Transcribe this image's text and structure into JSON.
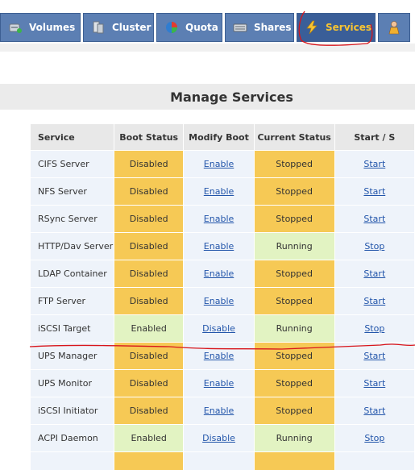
{
  "nav": {
    "tabs": [
      {
        "label": "Volumes",
        "icon": "volumes-icon",
        "active": false
      },
      {
        "label": "Cluster",
        "icon": "cluster-icon",
        "active": false
      },
      {
        "label": "Quota",
        "icon": "quota-icon",
        "active": false
      },
      {
        "label": "Shares",
        "icon": "shares-icon",
        "active": false
      },
      {
        "label": "Services",
        "icon": "lightning-icon",
        "active": true
      },
      {
        "label": "",
        "icon": "user-icon",
        "active": false
      }
    ]
  },
  "page": {
    "title": "Manage Services"
  },
  "table": {
    "headers": [
      "Service",
      "Boot Status",
      "Modify Boot",
      "Current Status",
      "Start / S"
    ],
    "rows": [
      {
        "service": "CIFS Server",
        "boot": "Disabled",
        "modify": "Enable",
        "current": "Stopped",
        "action": "Start"
      },
      {
        "service": "NFS Server",
        "boot": "Disabled",
        "modify": "Enable",
        "current": "Stopped",
        "action": "Start"
      },
      {
        "service": "RSync Server",
        "boot": "Disabled",
        "modify": "Enable",
        "current": "Stopped",
        "action": "Start"
      },
      {
        "service": "HTTP/Dav Server",
        "boot": "Disabled",
        "modify": "Enable",
        "current": "Running",
        "action": "Stop"
      },
      {
        "service": "LDAP Container",
        "boot": "Disabled",
        "modify": "Enable",
        "current": "Stopped",
        "action": "Start"
      },
      {
        "service": "FTP Server",
        "boot": "Disabled",
        "modify": "Enable",
        "current": "Stopped",
        "action": "Start"
      },
      {
        "service": "iSCSI Target",
        "boot": "Enabled",
        "modify": "Disable",
        "current": "Running",
        "action": "Stop"
      },
      {
        "service": "UPS Manager",
        "boot": "Disabled",
        "modify": "Enable",
        "current": "Stopped",
        "action": "Start"
      },
      {
        "service": "UPS Monitor",
        "boot": "Disabled",
        "modify": "Enable",
        "current": "Stopped",
        "action": "Start"
      },
      {
        "service": "iSCSI Initiator",
        "boot": "Disabled",
        "modify": "Enable",
        "current": "Stopped",
        "action": "Start"
      },
      {
        "service": "ACPI Daemon",
        "boot": "Enabled",
        "modify": "Disable",
        "current": "Running",
        "action": "Stop"
      },
      {
        "service": "",
        "boot": "",
        "modify": "",
        "current": "",
        "action": ""
      }
    ]
  },
  "colors": {
    "nav_bg": "#5c7fb3",
    "nav_active_text": "#f7c432",
    "status_orange": "#f6c955",
    "status_green": "#e2f3c2",
    "annotation_red": "#d8151b"
  }
}
